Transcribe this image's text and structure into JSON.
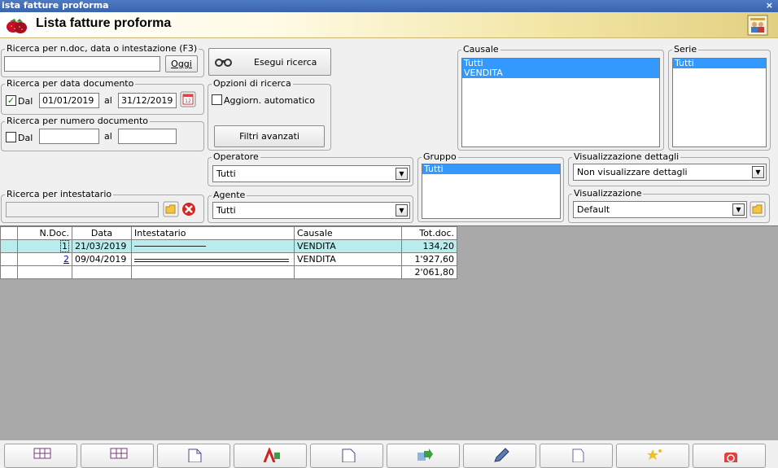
{
  "window": {
    "title": "ista fatture proforma",
    "close": "×"
  },
  "header": {
    "title": "Lista fatture proforma"
  },
  "search_ndoc": {
    "legend": "Ricerca per n.doc, data o intestazione (F3)",
    "value": "",
    "today_label": "Oggi"
  },
  "execute": {
    "label": "Esegui ricerca"
  },
  "search_date": {
    "legend": "Ricerca per data documento",
    "checked": true,
    "from_label": "Dal",
    "from": "01/01/2019",
    "to_label": "al",
    "to": "31/12/2019"
  },
  "options": {
    "legend": "Opzioni di ricerca",
    "auto_label": "Aggiorn. automatico",
    "advanced_label": "Filtri avanzati"
  },
  "search_num": {
    "legend": "Ricerca per numero documento",
    "from_label": "Dal",
    "from": "",
    "to_label": "al",
    "to": ""
  },
  "causale": {
    "legend": "Causale",
    "items": [
      "Tutti",
      "VENDITA"
    ]
  },
  "serie": {
    "legend": "Serie",
    "items": [
      "Tutti"
    ]
  },
  "operatore": {
    "legend": "Operatore",
    "value": "Tutti"
  },
  "gruppo": {
    "legend": "Gruppo",
    "items": [
      "Tutti"
    ]
  },
  "dettagli": {
    "legend": "Visualizzazione dettagli",
    "value": "Non visualizzare dettagli"
  },
  "intestatario": {
    "legend": "Ricerca per intestatario",
    "value": ""
  },
  "agente": {
    "legend": "Agente",
    "value": "Tutti"
  },
  "visualizzazione": {
    "legend": "Visualizzazione",
    "value": "Default"
  },
  "grid": {
    "headers": [
      "N.Doc.",
      "Data",
      "Intestatario",
      "Causale",
      "Tot.doc."
    ],
    "rows": [
      {
        "num": "1",
        "date": "21/03/2019",
        "causale": "VENDITA",
        "total": "134,20"
      },
      {
        "num": "2",
        "date": "09/04/2019",
        "causale": "VENDITA",
        "total": "1'927,60"
      }
    ],
    "grand_total": "2'061,80"
  },
  "colors": {
    "selection": "#3399ff",
    "row_highlight": "#b9ecec",
    "grid_background": "#a9a9a9"
  }
}
